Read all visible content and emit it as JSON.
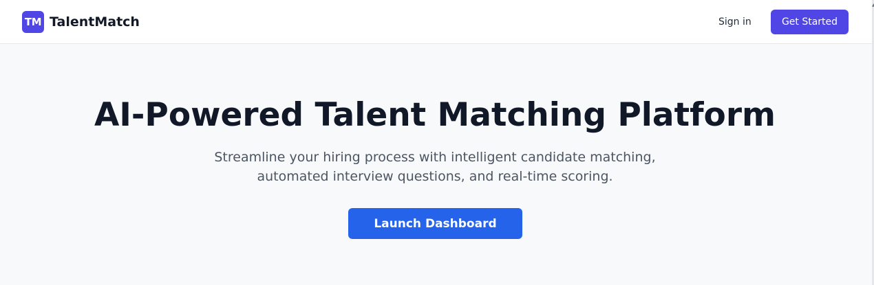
{
  "header": {
    "logo_initials": "TM",
    "brand_name": "TalentMatch",
    "signin_label": "Sign in",
    "get_started_label": "Get Started"
  },
  "hero": {
    "title": "AI-Powered Talent Matching Platform",
    "subtitle_line1": "Streamline your hiring process with intelligent candidate matching,",
    "subtitle_line2": "automated interview questions, and real-time scoring.",
    "cta_label": "Launch Dashboard"
  },
  "colors": {
    "brand": "#4f46e5",
    "cta": "#2563eb",
    "page_bg": "#f8f9fa",
    "text_dark": "#111827",
    "text_muted": "#4b5563"
  },
  "icons": {
    "scroll_arrow": "scroll-up-arrow-icon"
  }
}
